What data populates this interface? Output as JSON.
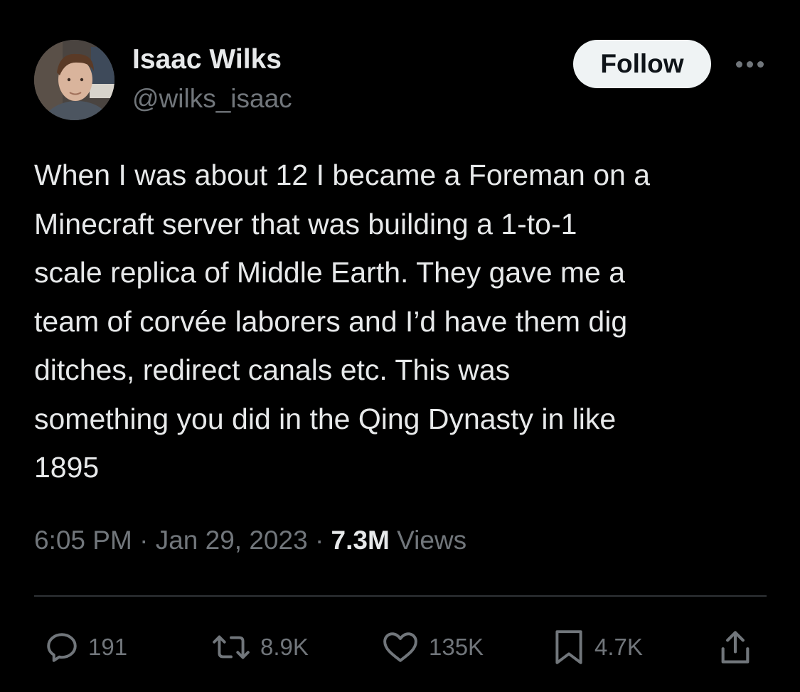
{
  "author": {
    "display_name": "Isaac Wilks",
    "handle": "@wilks_isaac",
    "avatar_icon": "profile-photo"
  },
  "header": {
    "follow_label": "Follow",
    "more_icon": "more-horizontal-icon"
  },
  "tweet": {
    "text": "When I was about 12 I became a Foreman on a\nMinecraft server that was building a 1-to-1\nscale replica of Middle Earth. They gave me a\nteam of corvée laborers and I’d have them dig\nditches, redirect canals etc. This was\nsomething you did in the Qing Dynasty in like\n1895"
  },
  "meta": {
    "time": "6:05 PM",
    "separator": "·",
    "date": "Jan 29, 2023",
    "views_count": "7.3M",
    "views_label": "Views"
  },
  "actions": {
    "replies": {
      "icon": "reply-icon",
      "count": "191"
    },
    "reposts": {
      "icon": "repost-icon",
      "count": "8.9K"
    },
    "likes": {
      "icon": "heart-icon",
      "count": "135K"
    },
    "bookmarks": {
      "icon": "bookmark-icon",
      "count": "4.7K"
    },
    "share": {
      "icon": "share-icon"
    }
  },
  "colors": {
    "background": "#000000",
    "primary_text": "#e7e9ea",
    "secondary_text": "#71767b",
    "divider": "#2f3336",
    "follow_button_bg": "#eff3f4",
    "follow_button_text": "#0f1419"
  }
}
